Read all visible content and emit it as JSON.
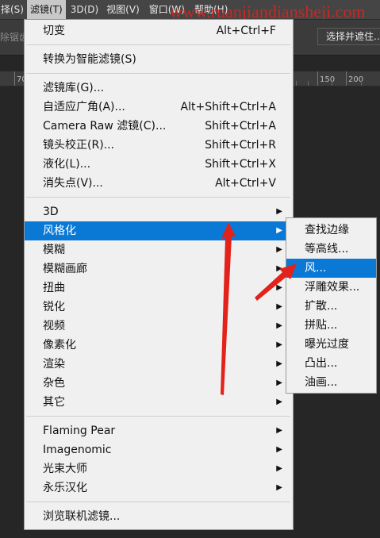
{
  "menubar": {
    "items": [
      "择(S)",
      "滤镜(T)",
      "3D(D)",
      "视图(V)",
      "窗口(W)",
      "帮助(H)"
    ],
    "active": "滤镜(T)"
  },
  "watermark": "www.ruanjiandiansheji.com",
  "options_bar": {
    "left_label": "除锯齿",
    "select_button": "选择并遮住..."
  },
  "ruler": {
    "ticks": [
      "70",
      "150",
      "200"
    ]
  },
  "filter_menu": {
    "items": [
      {
        "label": "切变",
        "shortcut": "Alt+Ctrl+F"
      },
      {
        "label": "转换为智能滤镜(S)"
      },
      {
        "label": "滤镜库(G)..."
      },
      {
        "label": "自适应广角(A)...",
        "shortcut": "Alt+Shift+Ctrl+A"
      },
      {
        "label": "Camera Raw 滤镜(C)...",
        "shortcut": "Shift+Ctrl+A"
      },
      {
        "label": "镜头校正(R)...",
        "shortcut": "Shift+Ctrl+R"
      },
      {
        "label": "液化(L)...",
        "shortcut": "Shift+Ctrl+X"
      },
      {
        "label": "消失点(V)...",
        "shortcut": "Alt+Ctrl+V"
      },
      {
        "label": "3D",
        "submenu": true
      },
      {
        "label": "风格化",
        "submenu": true,
        "highlighted": true
      },
      {
        "label": "模糊",
        "submenu": true
      },
      {
        "label": "模糊画廊",
        "submenu": true
      },
      {
        "label": "扭曲",
        "submenu": true
      },
      {
        "label": "锐化",
        "submenu": true
      },
      {
        "label": "视频",
        "submenu": true
      },
      {
        "label": "像素化",
        "submenu": true
      },
      {
        "label": "渲染",
        "submenu": true
      },
      {
        "label": "杂色",
        "submenu": true
      },
      {
        "label": "其它",
        "submenu": true
      },
      {
        "label": "Flaming Pear",
        "submenu": true
      },
      {
        "label": "Imagenomic",
        "submenu": true
      },
      {
        "label": "光束大师",
        "submenu": true
      },
      {
        "label": "永乐汉化",
        "submenu": true
      },
      {
        "label": "浏览联机滤镜..."
      }
    ]
  },
  "stylize_submenu": {
    "items": [
      {
        "label": "查找边缘"
      },
      {
        "label": "等高线..."
      },
      {
        "label": "风...",
        "highlighted": true
      },
      {
        "label": "浮雕效果..."
      },
      {
        "label": "扩散..."
      },
      {
        "label": "拼贴..."
      },
      {
        "label": "曝光过度"
      },
      {
        "label": "凸出..."
      },
      {
        "label": "油画..."
      }
    ]
  },
  "colors": {
    "highlight": "#0a79d6",
    "annotation_arrow": "#e2221b",
    "menu_background": "#f0f0f0",
    "app_background": "#262626"
  },
  "icons": {
    "submenu_arrow": "triangle-right-icon",
    "annotation": "red-arrow-icon"
  }
}
